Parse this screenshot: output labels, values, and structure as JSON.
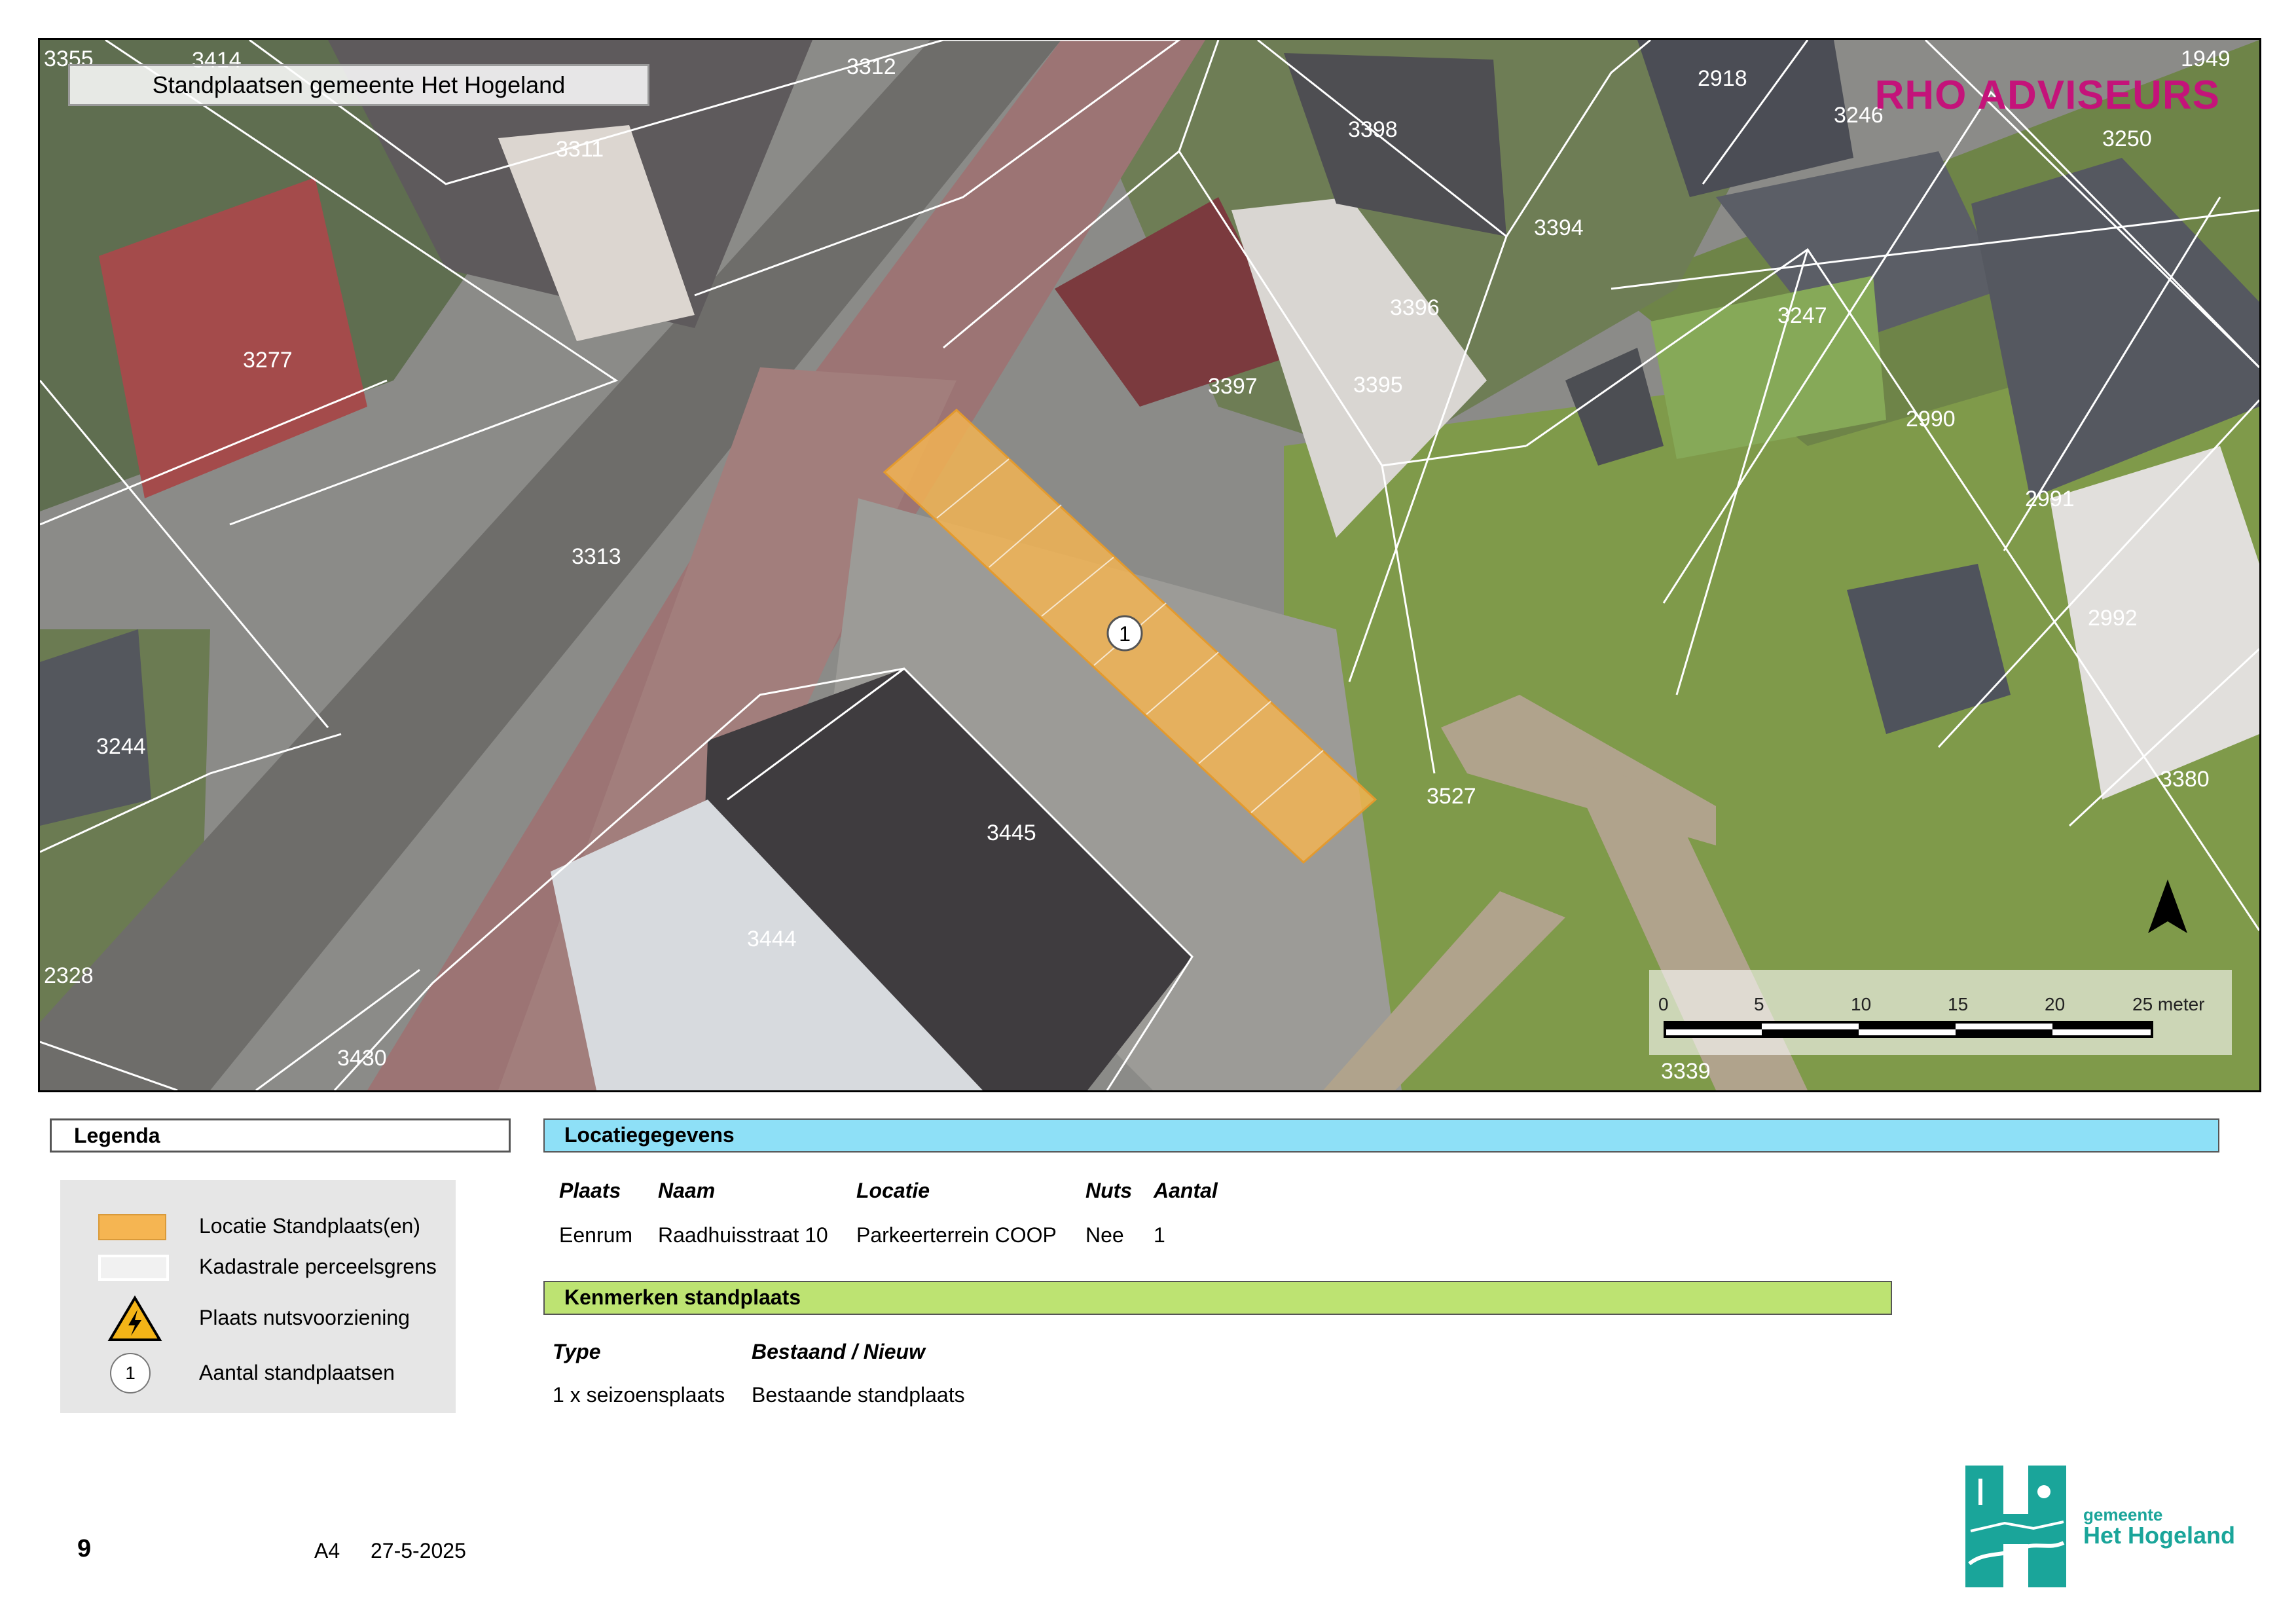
{
  "map": {
    "title": "Standplaatsen gemeente Het Hogeland",
    "brand": "RHO ADVISEURS",
    "marker_label": "1",
    "north_icon": "north-arrow-icon",
    "parcel_labels": [
      "3355",
      "3414",
      "3312",
      "3311",
      "3277",
      "3313",
      "3244",
      "2328",
      "3430",
      "3444",
      "3445",
      "3398",
      "3394",
      "3396",
      "3397",
      "3395",
      "2918",
      "3246",
      "3250",
      "1949",
      "3247",
      "2990",
      "2991",
      "2992",
      "3380",
      "3527",
      "3339"
    ],
    "scale": {
      "ticks": [
        "0",
        "5",
        "10",
        "15",
        "20"
      ],
      "last_tick": "25 meter"
    }
  },
  "legend": {
    "title": "Legenda",
    "items": [
      {
        "label": "Locatie Standplaats(en)",
        "icon": "orange-fill-swatch",
        "color": "#f5b552"
      },
      {
        "label": "Kadastrale perceelsgrens",
        "icon": "parcel-boundary-swatch"
      },
      {
        "label": "Plaats nutsvoorziening",
        "icon": "electricity-warning-icon",
        "color": "#f4b417"
      },
      {
        "label": "Aantal standplaatsen",
        "icon": "count-circle-icon",
        "value": "1"
      }
    ]
  },
  "location": {
    "title": "Locatiegegevens",
    "headers": [
      "Plaats",
      "Naam",
      "Locatie",
      "Nuts",
      "Aantal"
    ],
    "row": [
      "Eenrum",
      "Raadhuisstraat 10",
      "Parkeerterrein COOP",
      "Nee",
      "1"
    ]
  },
  "features": {
    "title": "Kenmerken standplaats",
    "headers": [
      "Type",
      "Bestaand / Nieuw"
    ],
    "row": [
      "1 x seizoensplaats",
      "Bestaande standplaats"
    ]
  },
  "footer": {
    "page": "9",
    "paper": "A4",
    "date": "27-5-2025",
    "logo_small": "gemeente",
    "logo_big": "Het Hogeland"
  },
  "colors": {
    "accent": "#c4137a",
    "blue_bar": "#8ee0f7",
    "green_bar": "#bde372",
    "standplaats": "#f5b552"
  }
}
